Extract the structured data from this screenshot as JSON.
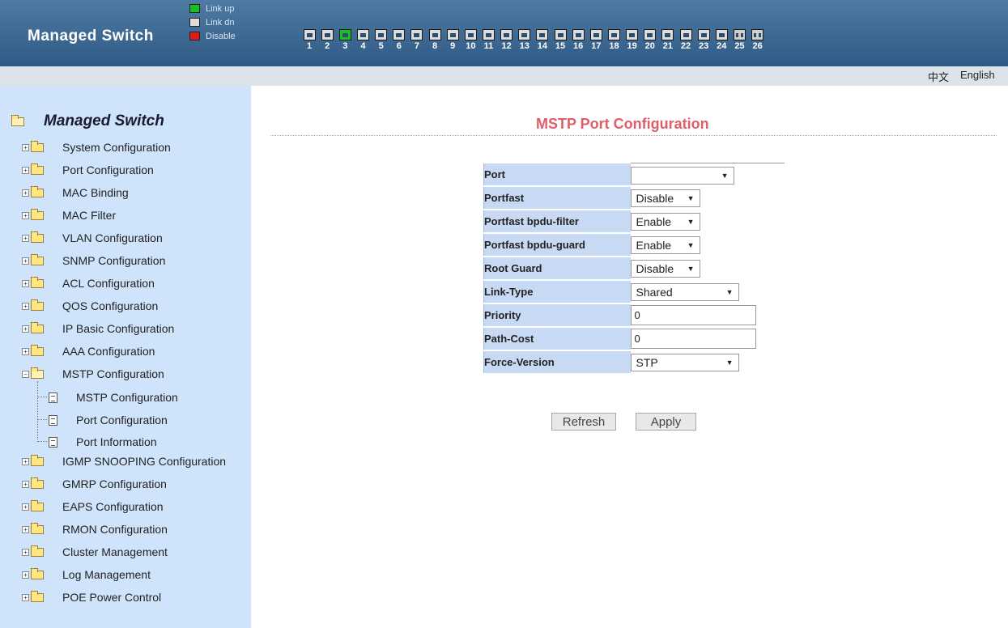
{
  "header": {
    "title": "Managed Switch",
    "legend": [
      {
        "label": "Link up",
        "color": "#17c21f"
      },
      {
        "label": "Link dn",
        "color": "#dddddd"
      },
      {
        "label": "Disable",
        "color": "#e01b1b"
      }
    ],
    "ports": [
      "1",
      "2",
      "3",
      "4",
      "5",
      "6",
      "7",
      "8",
      "9",
      "10",
      "11",
      "12",
      "13",
      "14",
      "15",
      "16",
      "17",
      "18",
      "19",
      "20",
      "21",
      "22",
      "23",
      "24",
      "25",
      "26"
    ],
    "ports_up": [
      "3"
    ]
  },
  "lang": {
    "chinese": "中文",
    "english": "English"
  },
  "sidebar": {
    "root": "Managed Switch",
    "items": [
      {
        "label": "System Configuration"
      },
      {
        "label": "Port Configuration"
      },
      {
        "label": "MAC Binding"
      },
      {
        "label": "MAC Filter"
      },
      {
        "label": "VLAN Configuration"
      },
      {
        "label": "SNMP Configuration"
      },
      {
        "label": "ACL Configuration"
      },
      {
        "label": "QOS Configuration"
      },
      {
        "label": "IP Basic Configuration"
      },
      {
        "label": "AAA Configuration"
      },
      {
        "label": "MSTP Configuration"
      },
      {
        "label": "IGMP SNOOPING Configuration"
      },
      {
        "label": "GMRP Configuration"
      },
      {
        "label": "EAPS Configuration"
      },
      {
        "label": "RMON Configuration"
      },
      {
        "label": "Cluster Management"
      },
      {
        "label": "Log Management"
      },
      {
        "label": "POE Power Control"
      }
    ],
    "mstp_children": [
      {
        "label": "MSTP Configuration"
      },
      {
        "label": "Port Configuration"
      },
      {
        "label": "Port Information"
      }
    ]
  },
  "main": {
    "title": "MSTP Port Configuration",
    "fields": [
      {
        "label": "Port",
        "value": ""
      },
      {
        "label": "Portfast",
        "value": "Disable"
      },
      {
        "label": "Portfast bpdu-filter",
        "value": "Enable"
      },
      {
        "label": "Portfast bpdu-guard",
        "value": "Enable"
      },
      {
        "label": "Root Guard",
        "value": "Disable"
      },
      {
        "label": "Link-Type",
        "value": "Shared"
      },
      {
        "label": "Priority",
        "value": "0"
      },
      {
        "label": "Path-Cost",
        "value": "0"
      },
      {
        "label": "Force-Version",
        "value": "STP"
      }
    ],
    "refresh_label": "Refresh",
    "apply_label": "Apply"
  }
}
